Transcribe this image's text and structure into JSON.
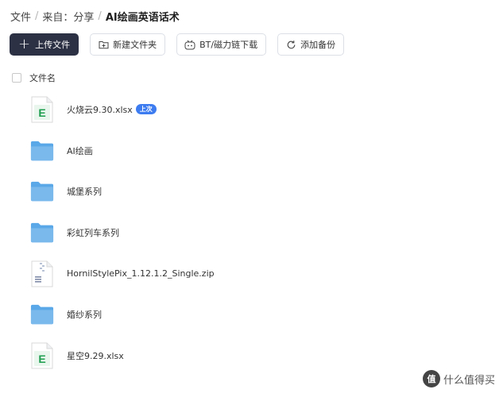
{
  "breadcrumb": {
    "items": [
      "文件",
      "来自：分享"
    ],
    "separator": "/",
    "current": "AI绘画英语话术"
  },
  "toolbar": {
    "upload_label": "上传文件",
    "new_folder_label": "新建文件夹",
    "bt_download_label": "BT/磁力链下载",
    "add_backup_label": "添加备份"
  },
  "list_header": {
    "name_column": "文件名"
  },
  "files": [
    {
      "name": "火烧云9.30.xlsx",
      "type": "excel",
      "badge": "上次"
    },
    {
      "name": "AI绘画",
      "type": "folder"
    },
    {
      "name": "城堡系列",
      "type": "folder"
    },
    {
      "name": "彩虹列车系列",
      "type": "folder"
    },
    {
      "name": "HornilStylePix_1.12.1.2_Single.zip",
      "type": "zip"
    },
    {
      "name": "婚纱系列",
      "type": "folder"
    },
    {
      "name": "星空9.29.xlsx",
      "type": "excel"
    }
  ],
  "watermark": {
    "logo": "值",
    "text": "什么值得买"
  },
  "colors": {
    "primary_button": "#2d3144",
    "badge": "#3d7cf0",
    "folder": "#5aa8e8",
    "excel_green": "#1e9e4e"
  }
}
